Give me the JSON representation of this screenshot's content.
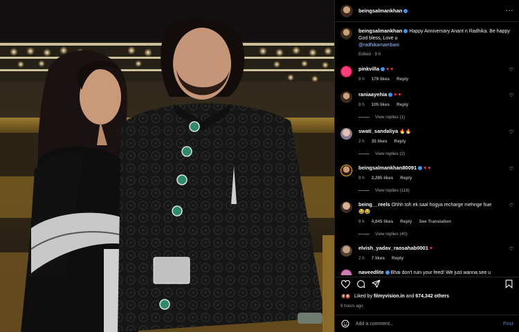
{
  "header": {
    "username": "beingsalmankhan"
  },
  "caption": {
    "username": "beingsalmankhan",
    "text": "Happy Anniversary Anant n Radhika. Be happy God bless, Love u",
    "mention": "@radhikamambani",
    "meta": "Edited · 9 h"
  },
  "comments": [
    {
      "username": "pinkvilla",
      "text": "",
      "emoji": "♥ ♥",
      "time": "9 h",
      "likes": "179 likes",
      "reply": "Reply",
      "extra": "",
      "replies": ""
    },
    {
      "username": "raniaayehia",
      "text": "",
      "emoji": "♥ ♥",
      "time": "9 h",
      "likes": "105 likes",
      "reply": "Reply",
      "extra": "",
      "replies": "View replies (1)"
    },
    {
      "username": "swati_sandaliya",
      "text": "",
      "emoji": "🔥🔥",
      "time": "2 h",
      "likes": "35 likes",
      "reply": "Reply",
      "extra": "",
      "replies": "View replies (2)"
    },
    {
      "username": "beingsalmankhan80091",
      "text": "",
      "emoji": "♥ ♥",
      "time": "9 h",
      "likes": "2,295 likes",
      "reply": "Reply",
      "extra": "",
      "replies": "View replies (118)"
    },
    {
      "username": "being__reels",
      "text": "Ohhh toh ek saal hogya recharge mehnge hue",
      "emoji": "",
      "time": "9 h",
      "likes": "4,645 likes",
      "reply": "Reply",
      "extra": "See Translation",
      "replies": "View replies (40)"
    },
    {
      "username": "elvish_yadav_raosahab0001",
      "text": "",
      "emoji": "♥",
      "time": "2 h",
      "likes": "7 likes",
      "reply": "Reply",
      "extra": "",
      "replies": ""
    },
    {
      "username": "naveedlite",
      "text": "Bhai don't ruin your feed! We just wanna see u",
      "emoji": "",
      "time": "",
      "likes": "",
      "reply": "",
      "extra": "",
      "replies": ""
    }
  ],
  "likes": {
    "prefix": "Liked by",
    "user": "filmyvision.in",
    "middle": "and",
    "count": "674,342 others"
  },
  "time_ago": "9 hours ago",
  "add_comment": {
    "placeholder": "Add a comment...",
    "post": "Post"
  },
  "colors": {
    "verified": "#3897f0",
    "heart": "#ff3040",
    "mention": "#a8c7ff"
  }
}
